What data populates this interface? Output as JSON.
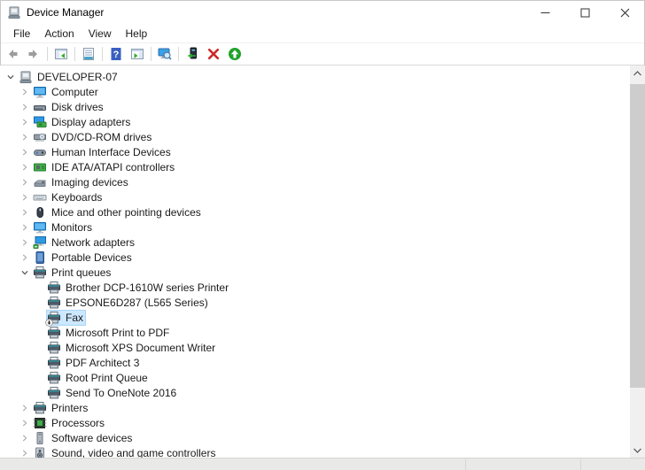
{
  "window": {
    "title": "Device Manager",
    "controls": [
      {
        "name": "minimize",
        "icon": "minimize-icon"
      },
      {
        "name": "maximize",
        "icon": "maximize-icon"
      },
      {
        "name": "close",
        "icon": "close-icon"
      }
    ]
  },
  "menu": {
    "items": [
      "File",
      "Action",
      "View",
      "Help"
    ]
  },
  "toolbar": {
    "items": [
      {
        "type": "button",
        "name": "back",
        "icon": "arrow-left"
      },
      {
        "type": "button",
        "name": "forward",
        "icon": "arrow-right"
      },
      {
        "type": "separator"
      },
      {
        "type": "button",
        "name": "show-hide-console-tree",
        "icon": "console-tree"
      },
      {
        "type": "separator"
      },
      {
        "type": "button",
        "name": "properties",
        "icon": "properties"
      },
      {
        "type": "separator"
      },
      {
        "type": "button",
        "name": "help",
        "icon": "help"
      },
      {
        "type": "button",
        "name": "show-hide-action-pane",
        "icon": "action-pane"
      },
      {
        "type": "separator"
      },
      {
        "type": "button",
        "name": "scan-for-hardware-changes",
        "icon": "scan-hardware"
      },
      {
        "type": "separator"
      },
      {
        "type": "button",
        "name": "update-driver",
        "icon": "update-driver"
      },
      {
        "type": "button",
        "name": "uninstall-device",
        "icon": "uninstall"
      },
      {
        "type": "button",
        "name": "enable-device",
        "icon": "enable-device"
      }
    ]
  },
  "tree": {
    "items": [
      {
        "label": "DEVELOPER-07",
        "level": 0,
        "state": "expanded",
        "icon": "computer-root",
        "selected": false,
        "badge": null
      },
      {
        "label": "Computer",
        "level": 1,
        "state": "collapsed",
        "icon": "computer",
        "selected": false,
        "badge": null
      },
      {
        "label": "Disk drives",
        "level": 1,
        "state": "collapsed",
        "icon": "disk-drive",
        "selected": false,
        "badge": null
      },
      {
        "label": "Display adapters",
        "level": 1,
        "state": "collapsed",
        "icon": "display-adapter",
        "selected": false,
        "badge": null
      },
      {
        "label": "DVD/CD-ROM drives",
        "level": 1,
        "state": "collapsed",
        "icon": "dvd-drive",
        "selected": false,
        "badge": null
      },
      {
        "label": "Human Interface Devices",
        "level": 1,
        "state": "collapsed",
        "icon": "hid",
        "selected": false,
        "badge": null
      },
      {
        "label": "IDE ATA/ATAPI controllers",
        "level": 1,
        "state": "collapsed",
        "icon": "ide-controller",
        "selected": false,
        "badge": null
      },
      {
        "label": "Imaging devices",
        "level": 1,
        "state": "collapsed",
        "icon": "imaging-device",
        "selected": false,
        "badge": null
      },
      {
        "label": "Keyboards",
        "level": 1,
        "state": "collapsed",
        "icon": "keyboard",
        "selected": false,
        "badge": null
      },
      {
        "label": "Mice and other pointing devices",
        "level": 1,
        "state": "collapsed",
        "icon": "mouse",
        "selected": false,
        "badge": null
      },
      {
        "label": "Monitors",
        "level": 1,
        "state": "collapsed",
        "icon": "monitor",
        "selected": false,
        "badge": null
      },
      {
        "label": "Network adapters",
        "level": 1,
        "state": "collapsed",
        "icon": "network-adapter",
        "selected": false,
        "badge": null
      },
      {
        "label": "Portable Devices",
        "level": 1,
        "state": "collapsed",
        "icon": "portable-device",
        "selected": false,
        "badge": null
      },
      {
        "label": "Print queues",
        "level": 1,
        "state": "expanded",
        "icon": "print-queue",
        "selected": false,
        "badge": null
      },
      {
        "label": "Brother DCP-1610W series Printer",
        "level": 2,
        "state": "leaf",
        "icon": "printer",
        "selected": false,
        "badge": null
      },
      {
        "label": "EPSONE6D287 (L565 Series)",
        "level": 2,
        "state": "leaf",
        "icon": "printer",
        "selected": false,
        "badge": null
      },
      {
        "label": "Fax",
        "level": 2,
        "state": "leaf",
        "icon": "printer",
        "selected": true,
        "badge": "disabled"
      },
      {
        "label": "Microsoft Print to PDF",
        "level": 2,
        "state": "leaf",
        "icon": "printer",
        "selected": false,
        "badge": null
      },
      {
        "label": "Microsoft XPS Document Writer",
        "level": 2,
        "state": "leaf",
        "icon": "printer",
        "selected": false,
        "badge": null
      },
      {
        "label": "PDF Architect 3",
        "level": 2,
        "state": "leaf",
        "icon": "printer",
        "selected": false,
        "badge": null
      },
      {
        "label": "Root Print Queue",
        "level": 2,
        "state": "leaf",
        "icon": "printer",
        "selected": false,
        "badge": null
      },
      {
        "label": "Send To OneNote 2016",
        "level": 2,
        "state": "leaf",
        "icon": "printer",
        "selected": false,
        "badge": null
      },
      {
        "label": "Printers",
        "level": 1,
        "state": "collapsed",
        "icon": "printer-category",
        "selected": false,
        "badge": null
      },
      {
        "label": "Processors",
        "level": 1,
        "state": "collapsed",
        "icon": "processor",
        "selected": false,
        "badge": null
      },
      {
        "label": "Software devices",
        "level": 1,
        "state": "collapsed",
        "icon": "software-device",
        "selected": false,
        "badge": null
      },
      {
        "label": "Sound, video and game controllers",
        "level": 1,
        "state": "collapsed",
        "icon": "sound",
        "selected": false,
        "badge": null
      }
    ]
  },
  "colors": {
    "selection_background": "#cce8ff",
    "uninstall_red": "#cf2a2a",
    "enable_green": "#1fa32a",
    "toolbar_separator": "#d9d9d9",
    "scrollbar_track": "#f0f0f0",
    "scrollbar_thumb": "#cdcdcd"
  }
}
